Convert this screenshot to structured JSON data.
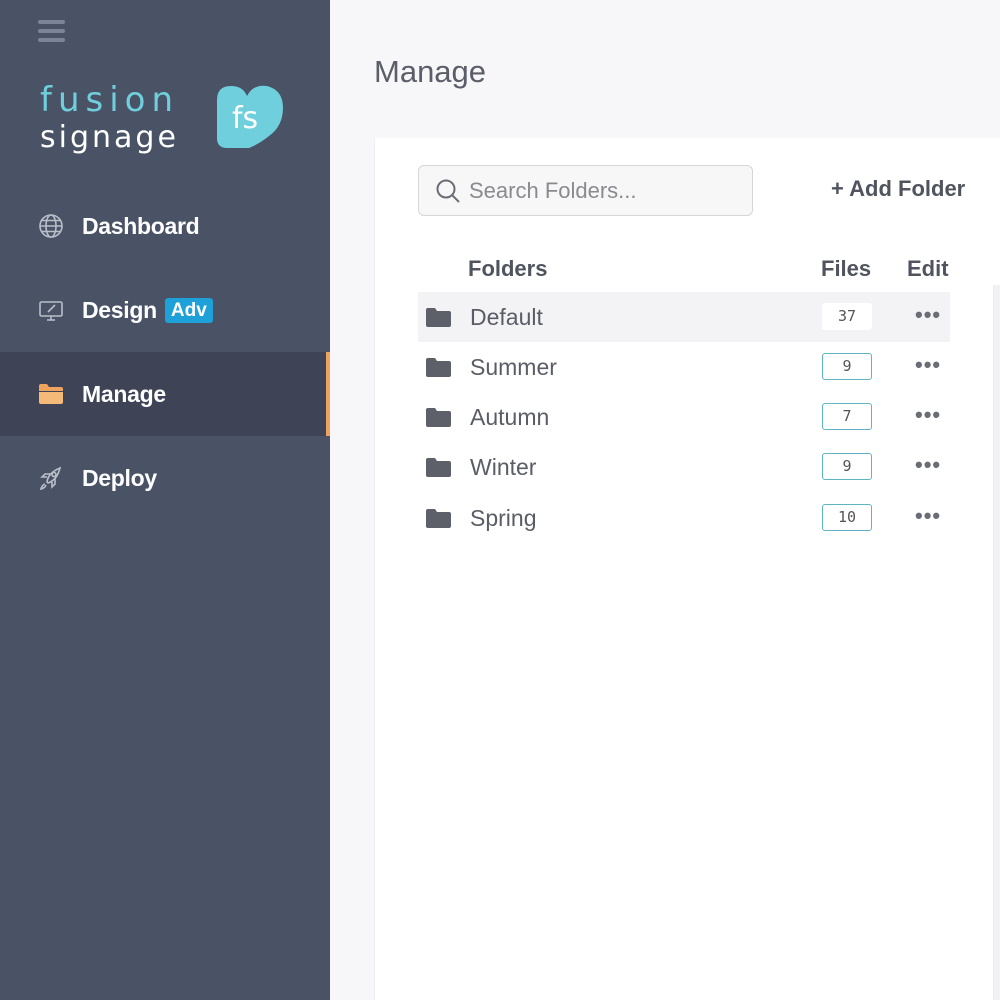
{
  "brand": {
    "word1": "fusion",
    "word2": "signage",
    "mark": "fs",
    "colors": {
      "teal": "#6fcfdc",
      "sidebar": "#4a5266",
      "accent": "#f0a35e",
      "badge": "#1ea0d8"
    }
  },
  "sidebar": {
    "menu_icon": "hamburger-icon",
    "items": [
      {
        "label": "Dashboard",
        "icon": "globe-icon",
        "active": false
      },
      {
        "label": "Design",
        "icon": "monitor-icon",
        "badge": "Adv",
        "active": false
      },
      {
        "label": "Manage",
        "icon": "folder-open-icon",
        "active": true
      },
      {
        "label": "Deploy",
        "icon": "rocket-icon",
        "active": false
      }
    ]
  },
  "main": {
    "title": "Manage",
    "search": {
      "placeholder": "Search Folders...",
      "value": ""
    },
    "add_folder_label": "+ Add Folder",
    "columns": {
      "folders": "Folders",
      "files": "Files",
      "edit": "Edit"
    },
    "rows": [
      {
        "name": "Default",
        "files": "37",
        "edit": "•••"
      },
      {
        "name": "Summer",
        "files": "9",
        "edit": "•••"
      },
      {
        "name": "Autumn",
        "files": "7",
        "edit": "•••"
      },
      {
        "name": "Winter",
        "files": "9",
        "edit": "•••"
      },
      {
        "name": "Spring",
        "files": "10",
        "edit": "•••"
      }
    ]
  }
}
